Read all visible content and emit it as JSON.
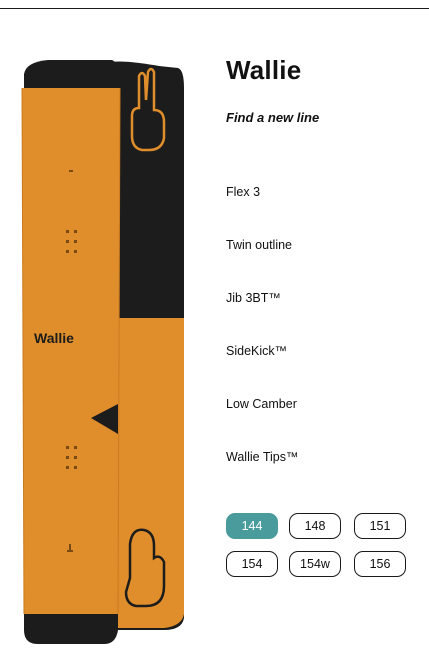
{
  "product": {
    "name": "Wallie",
    "tagline": "Find a new line",
    "board_text": "Wallie",
    "features": [
      "Flex 3",
      "Twin outline",
      "Jib 3BT™",
      "SideKick™",
      "Low Camber",
      "Wallie Tips™"
    ]
  },
  "sizes": {
    "options": [
      "144",
      "148",
      "151",
      "154",
      "154w",
      "156"
    ],
    "selected": "144",
    "selected_color": "#4a9b9b"
  },
  "colors": {
    "board_orange": "#e08e2b",
    "board_black": "#1c1c1c"
  },
  "icons": {
    "hand_graphic": "peace-sign-hand"
  }
}
